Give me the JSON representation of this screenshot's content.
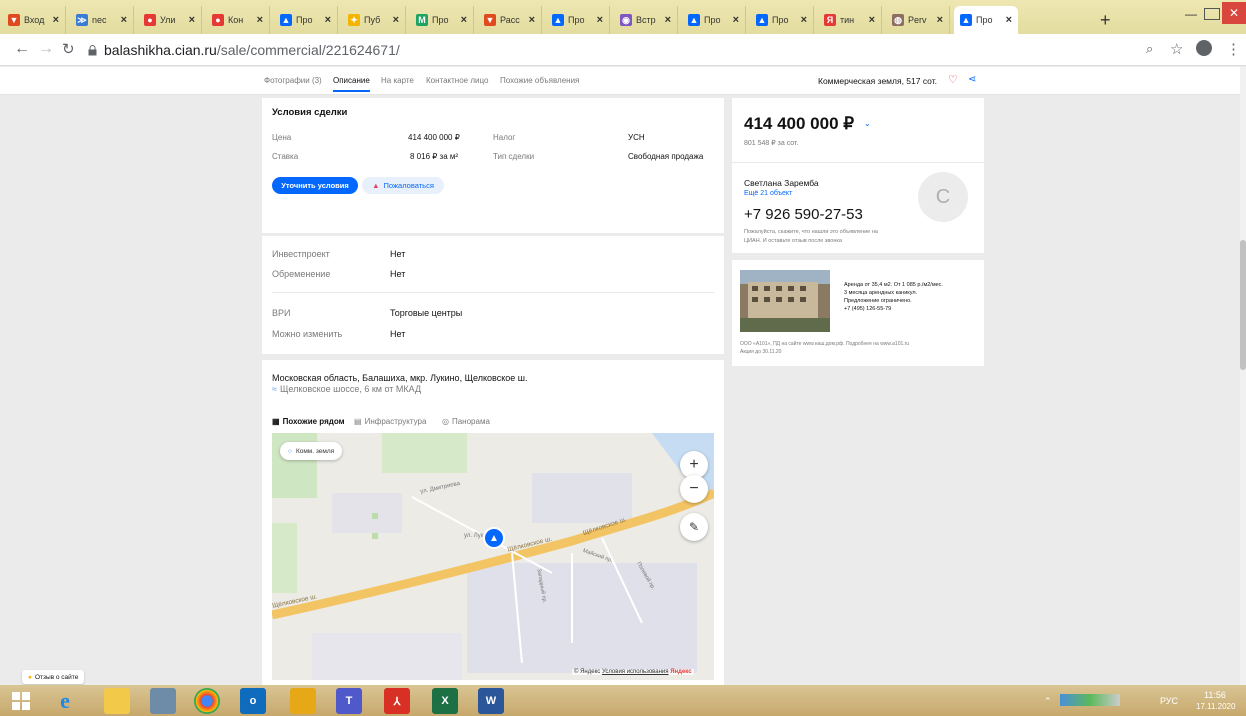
{
  "browser": {
    "tabs": [
      {
        "label": "Вход",
        "color": "#e04a1f",
        "glyph": "▼"
      },
      {
        "label": "nec",
        "color": "#3a7bd5",
        "glyph": "≫"
      },
      {
        "label": "Ули",
        "color": "#e53935",
        "glyph": "●"
      },
      {
        "label": "Кон",
        "color": "#e53935",
        "glyph": "●"
      },
      {
        "label": "Про",
        "color": "#0468ff",
        "glyph": "▲"
      },
      {
        "label": "Пуб",
        "color": "#f4b400",
        "glyph": "✦"
      },
      {
        "label": "Про",
        "color": "#1ea362",
        "glyph": "М"
      },
      {
        "label": "Расс",
        "color": "#e04a1f",
        "glyph": "▼"
      },
      {
        "label": "Про",
        "color": "#0468ff",
        "glyph": "▲"
      },
      {
        "label": "Встр",
        "color": "#7e57c2",
        "glyph": "◉"
      },
      {
        "label": "Про",
        "color": "#0468ff",
        "glyph": "▲"
      },
      {
        "label": "Про",
        "color": "#0468ff",
        "glyph": "▲"
      },
      {
        "label": "тин",
        "color": "#e53935",
        "glyph": "Я"
      },
      {
        "label": "Perv",
        "color": "#8d6e63",
        "glyph": "◍"
      },
      {
        "label": "Про",
        "color": "#0468ff",
        "glyph": "▲"
      }
    ],
    "new_tab": "+",
    "url_host": "balashikha.cian.ru",
    "url_path": "/sale/commercial/221624671/"
  },
  "nav": {
    "items": [
      "Фотографии (3)",
      "Описание",
      "На карте",
      "Контактное лицо",
      "Похожие объявления"
    ],
    "selected": "Описание",
    "summary": "Коммерческая земля, 517 сот."
  },
  "deal": {
    "title": "Условия сделки",
    "price_label": "Цена",
    "price_value": "414 400 000 ₽",
    "tax_label": "Налог",
    "tax_value": "УСН",
    "rate_label": "Ставка",
    "rate_value": "8 016 ₽ за м²",
    "type_label": "Тип сделки",
    "type_value": "Свободная продажа",
    "refine_button": "Уточнить условия",
    "complain_button": "Пожаловаться"
  },
  "features": [
    {
      "label": "Инвестпроект",
      "value": "Нет"
    },
    {
      "label": "Обременение",
      "value": "Нет"
    },
    {
      "label": "ВРИ",
      "value": "Торговые центры"
    },
    {
      "label": "Можно изменить",
      "value": "Нет"
    }
  ],
  "location": {
    "address": "Московская область, Балашиха, мкр. Лукино, Щелковское ш.",
    "highway": "Щелковское шоссе, 6 км от МКАД",
    "tabs": [
      "Похожие рядом",
      "Инфраструктура",
      "Панорама"
    ],
    "map_chip": "Комм. земля",
    "map_labels": [
      "ул. Дмитриева",
      "ул. Лукино",
      "Щёлковское ш.",
      "Щёлковское ш.",
      "Щёлковское ш.",
      "Западный пр.",
      "Майский пр.",
      "Полевой пр."
    ],
    "copyright": "© Яндекс",
    "terms": "Условия использования",
    "brand": "Яндекс"
  },
  "sidebar": {
    "price": "414 400 000 ₽",
    "price_per": "801 548 ₽ за сот.",
    "agent_name": "Светлана Заремба",
    "agent_more": "Ещё 21 объект",
    "phone": "+7 926 590-27-53",
    "note_1": "Пожалуйста, скажите, что нашли это объявление на",
    "note_2": "ЦИАН. И оставьте отзыв после звонка",
    "avatar_letter": "С"
  },
  "ad": {
    "line1": "Аренда от 35,4 м2. От 1 085 р./м2/мес.",
    "line2": "3 месяца арендных каникул.",
    "line3": "Предложение ограничено.",
    "phone": "+7 (495) 126-55-79",
    "legal1": "ООО «А101», ПД на сайте www.наш.дом.рф. Подробнее на www.a101.ru",
    "legal2": "Акция до 30.11.20"
  },
  "feedback": "Отзыв о сайте",
  "taskbar": {
    "lang": "РУС",
    "time": "11:56",
    "date": "17.11.2020"
  },
  "colors": {
    "accent": "#0468ff",
    "complain": "#e84260",
    "road": "#f5c96b"
  }
}
